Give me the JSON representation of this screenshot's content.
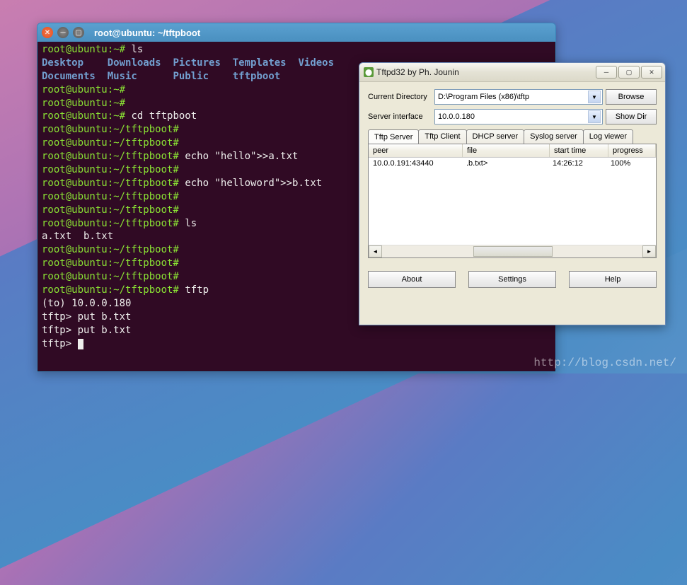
{
  "terminal": {
    "title": "root@ubuntu: ~/tftpboot",
    "prompt_home": "root@ubuntu:~#",
    "prompt_boot": "root@ubuntu:~/tftpboot#",
    "cmd_ls": "ls",
    "dirs": {
      "desktop": "Desktop",
      "downloads": "Downloads",
      "pictures": "Pictures",
      "templates": "Templates",
      "videos": "Videos",
      "documents": "Documents",
      "music": "Music",
      "public": "Public",
      "tftpboot": "tftpboot"
    },
    "cmd_cd": "cd tftpboot",
    "cmd_echo_a": "echo \"hello\">>a.txt",
    "cmd_echo_b": "echo \"helloword\">>b.txt",
    "ls_out": "a.txt  b.txt",
    "cmd_tftp": "tftp",
    "tftp_to": "(to) 10.0.0.180",
    "tftp_prompt": "tftp>",
    "tftp_put": "put b.txt"
  },
  "tftpd": {
    "title": "Tftpd32 by Ph. Jounin",
    "labels": {
      "curdir": "Current Directory",
      "iface": "Server interface"
    },
    "curdir": "D:\\Program Files (x86)\\tftp",
    "iface": "10.0.0.180",
    "buttons": {
      "browse": "Browse",
      "showdir": "Show Dir",
      "about": "About",
      "settings": "Settings",
      "help": "Help"
    },
    "tabs": {
      "server": "Tftp Server",
      "client": "Tftp Client",
      "dhcp": "DHCP server",
      "syslog": "Syslog server",
      "log": "Log viewer"
    },
    "cols": {
      "peer": "peer",
      "file": "file",
      "start": "start time",
      "progress": "progress"
    },
    "row": {
      "peer": "10.0.0.191:43440",
      "file": ".b.txt>",
      "start": "14:26:12",
      "progress": "100%"
    }
  },
  "watermark": "http://blog.csdn.net/"
}
